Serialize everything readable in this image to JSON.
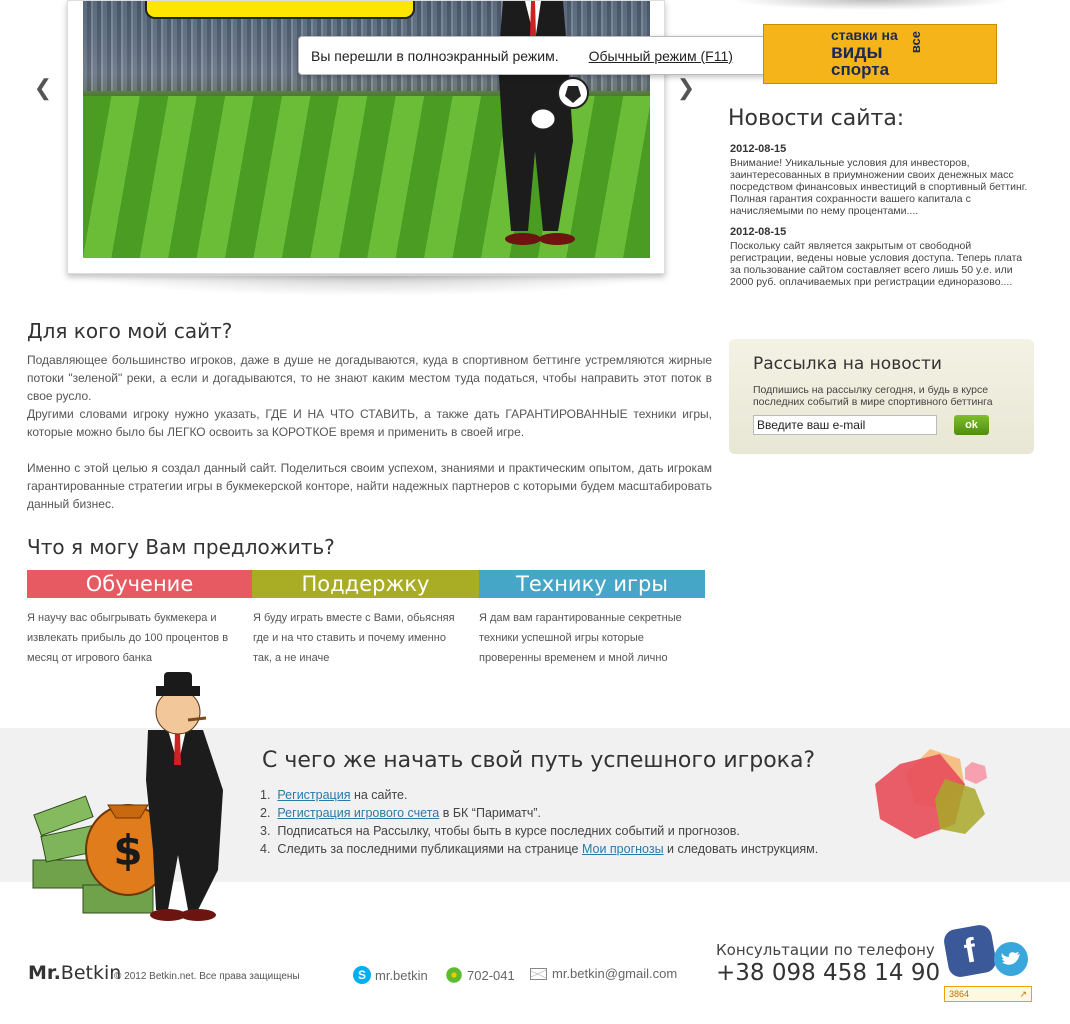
{
  "toast": {
    "message": "Вы перешли в полноэкранный режим.",
    "link": "Обычный режим (F11)"
  },
  "ad": {
    "line1": "ставки на",
    "line2": "виды",
    "line3": "спорта",
    "vertical": "все"
  },
  "news": {
    "title": "Новости сайта:",
    "items": [
      {
        "date": "2012-08-15",
        "text": "Внимание! Уникальные условия для инвесторов, заинтересованных в приумножении своих денежных масс посредством финансовых инвестиций в спортивный беттинг. Полная гарантия сохранности вашего капитала с начисляемыми по нему процентами...."
      },
      {
        "date": "2012-08-15",
        "text": "Поскольку сайт является закрытым от свободной регистрации, ведены новые условия доступа. Теперь плата за пользование сайтом составляет всего лишь 50 у.е. или 2000 руб. оплачиваемых при регистрации единоразово...."
      }
    ]
  },
  "subscribe": {
    "title": "Рассылка на новости",
    "text": "Подпишись на рассылку сегодня, и будь в курсе последних событий в мире спортивного беттинга",
    "input_value": "Введите ваш e-mail",
    "button": "ok"
  },
  "main": {
    "heading1": "Для кого мой сайт?",
    "para1": "Подавляющее большинство игроков, даже в душе не догадываются, куда в спортивном беттинге устремляются жирные потоки \"зеленой\" реки, а если и догадываются, то не знают каким местом туда податься, чтобы направить этот поток в свое русло.",
    "para2": "Другими словами игроку нужно указать, ГДЕ И НА ЧТО СТАВИТЬ, а также дать ГАРАНТИРОВАННЫЕ техники игры, которые можно было бы ЛЕГКО освоить за КОРОТКОЕ время и применить в своей игре.",
    "para3": "Именно с этой целью я создал данный сайт. Поделиться своим успехом, знаниями и практическим опытом, дать игрокам гарантированные стратегии игры в букмекерской конторе, найти надежных партнеров с которыми будем масштабировать данный бизнес.",
    "heading2": "Что я могу Вам предложить?",
    "offers": [
      {
        "title": "Обучение",
        "text": "Я научу вас обыгрывать букмекера и извлекать прибыль до 100 процентов в месяц от игрового банка",
        "color": "#e85a62"
      },
      {
        "title": "Поддержку",
        "text": "Я буду играть вместе с Вами, обьясняя где и на что ставить и почему именно так, а не иначе",
        "color": "#a8ad25"
      },
      {
        "title": "Технику игры",
        "text": "Я дам вам гарантированные секретные техники успешной игры которые проверенны временем и мной лично",
        "color": "#45a6c8"
      }
    ]
  },
  "start": {
    "title": "С чего же начать свой путь успешного игрока?",
    "steps": [
      {
        "num": "1.",
        "link": "Регистрация",
        "rest": " на сайте."
      },
      {
        "num": "2.",
        "link": "Регистрация игрового счета",
        "rest": " в БК “Париматч”."
      },
      {
        "num": "3.",
        "link": "",
        "rest": "Подписаться на Рассылку, чтобы быть в курсе последних событий и прогнозов."
      },
      {
        "num": "4.",
        "pre": "Следить за последними публикациями на странице ",
        "link": "Мои прогнозы",
        "rest": " и следовать инструкциям."
      }
    ]
  },
  "footer": {
    "logo_mr": "Mr.",
    "logo_name": "Betkin",
    "copyright": "© 2012 Betkin.net. Все права защищены",
    "skype": "mr.betkin",
    "icq": "702-041",
    "email": "mr.betkin@gmail.com",
    "phone_label": "Консультации по телефону",
    "phone": "+38 098 458 14 90",
    "counter": "3864"
  }
}
